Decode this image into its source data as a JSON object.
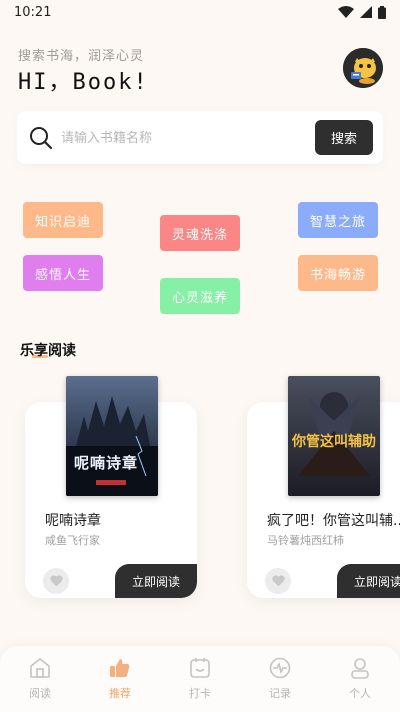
{
  "status": {
    "time": "10:21"
  },
  "header": {
    "subtitle": "搜索书海，润泽心灵",
    "greeting": "HI，Book!"
  },
  "search": {
    "placeholder": "请输入书籍名称",
    "button_label": "搜索"
  },
  "tags": [
    {
      "label": "知识启迪",
      "color": "#fdb98a"
    },
    {
      "label": "灵魂洗涤",
      "color": "#fa8686"
    },
    {
      "label": "智慧之旅",
      "color": "#8aacfa"
    },
    {
      "label": "感悟人生",
      "color": "#e07ef0"
    },
    {
      "label": "心灵滋养",
      "color": "#86f0a6"
    },
    {
      "label": "书海畅游",
      "color": "#fdb98a"
    }
  ],
  "section": {
    "title": "乐享阅读"
  },
  "books": [
    {
      "title": "呢喃诗章",
      "author": "咸鱼飞行家",
      "button": "立即阅读",
      "cover_text": "呢喃诗章"
    },
    {
      "title": "疯了吧！你管这叫辅...",
      "author": "马铃薯炖西红柿",
      "button": "立即阅读",
      "cover_text": "你管这叫辅助"
    }
  ],
  "tabbar": {
    "items": [
      {
        "label": "阅读",
        "icon": "home-icon"
      },
      {
        "label": "推荐",
        "icon": "thumbs-up-icon"
      },
      {
        "label": "打卡",
        "icon": "checkin-icon"
      },
      {
        "label": "记录",
        "icon": "pulse-icon"
      },
      {
        "label": "个人",
        "icon": "person-icon"
      }
    ],
    "active_index": 1
  }
}
